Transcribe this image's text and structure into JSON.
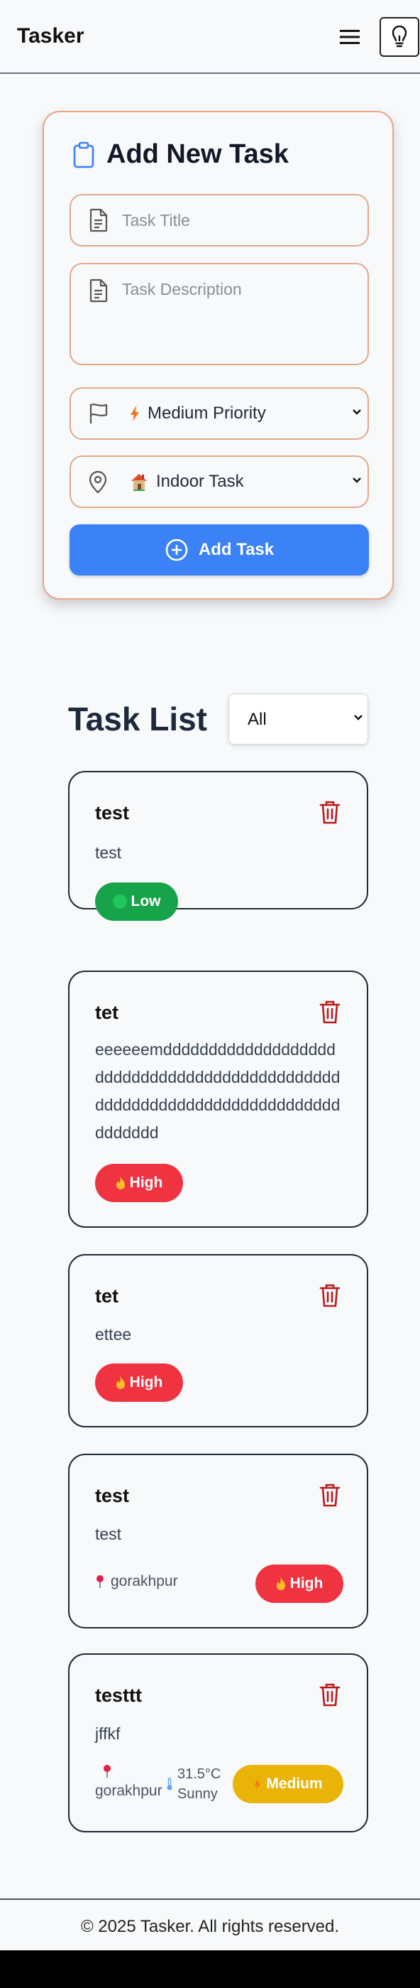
{
  "header": {
    "brand": "Tasker",
    "menu_icon": "hamburger-icon",
    "theme_icon": "lightbulb-icon"
  },
  "form": {
    "title": "Add New Task",
    "title_placeholder": "Task Title",
    "description_placeholder": "Task Description",
    "priority_selected": "Medium Priority",
    "type_selected": "Indoor Task",
    "submit_label": "Add Task"
  },
  "list": {
    "title": "Task List",
    "filter_selected": "All",
    "tasks": [
      {
        "title": "test",
        "description": "test",
        "priority": "Low"
      },
      {
        "title": "tet",
        "description": "eeeeeemdddddddddddddddddddddddddddddddddddddddddddddddddddddddddddddddddddddddddddddddd",
        "priority": "High"
      },
      {
        "title": "tet",
        "description": "ettee",
        "priority": "High"
      },
      {
        "title": "test",
        "description": "test",
        "location": "gorakhpur",
        "priority": "High"
      },
      {
        "title": "testtt",
        "description": "jffkf",
        "location": "gorakhpur",
        "temperature": "31.5°C",
        "weather": "Sunny",
        "priority": "Medium"
      }
    ]
  },
  "footer": {
    "text": "© 2025 Tasker. All rights reserved."
  },
  "colors": {
    "accent": "#3b82f6",
    "low": "#16a34a",
    "high": "#ef3340",
    "medium": "#eab308",
    "trash": "#b91c1c"
  }
}
